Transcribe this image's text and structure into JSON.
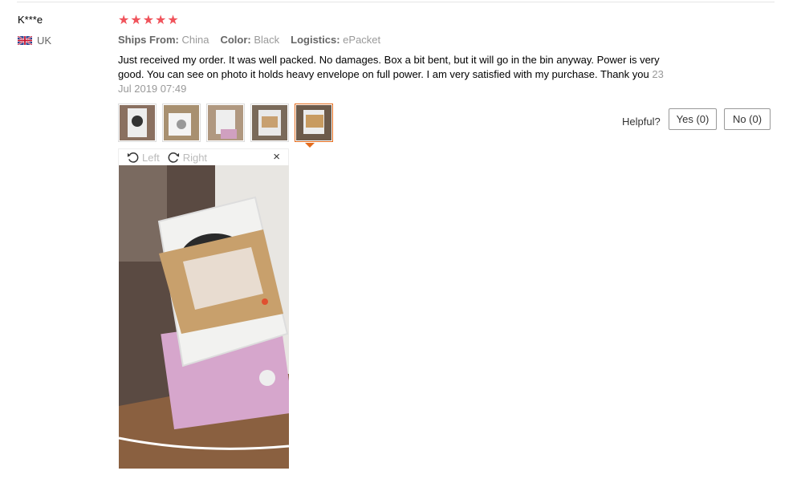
{
  "reviewer": {
    "name": "K***e",
    "country": "UK",
    "flag": "gb-flag-icon"
  },
  "rating": {
    "stars": 5,
    "max": 5,
    "color": "#f0535b"
  },
  "meta": [
    {
      "key": "Ships From:",
      "value": "China"
    },
    {
      "key": "Color:",
      "value": "Black"
    },
    {
      "key": "Logistics:",
      "value": "ePacket"
    }
  ],
  "review": {
    "text": "Just received my order. It was well packed. No damages. Box a bit bent, but it will go in the bin anyway. Power is very good. You can see on photo it holds heavy envelope on full power. I am very satisfied with my purchase. Thank you",
    "date": "23 Jul 2019 07:49"
  },
  "thumbnails": {
    "count": 5,
    "active_index": 4
  },
  "viewer": {
    "rotate_left": "Left",
    "rotate_right": "Right",
    "close": "×"
  },
  "helpful": {
    "label": "Helpful?",
    "yes": "Yes (0)",
    "no": "No (0)"
  },
  "colors": {
    "accent": "#e46c1d"
  }
}
